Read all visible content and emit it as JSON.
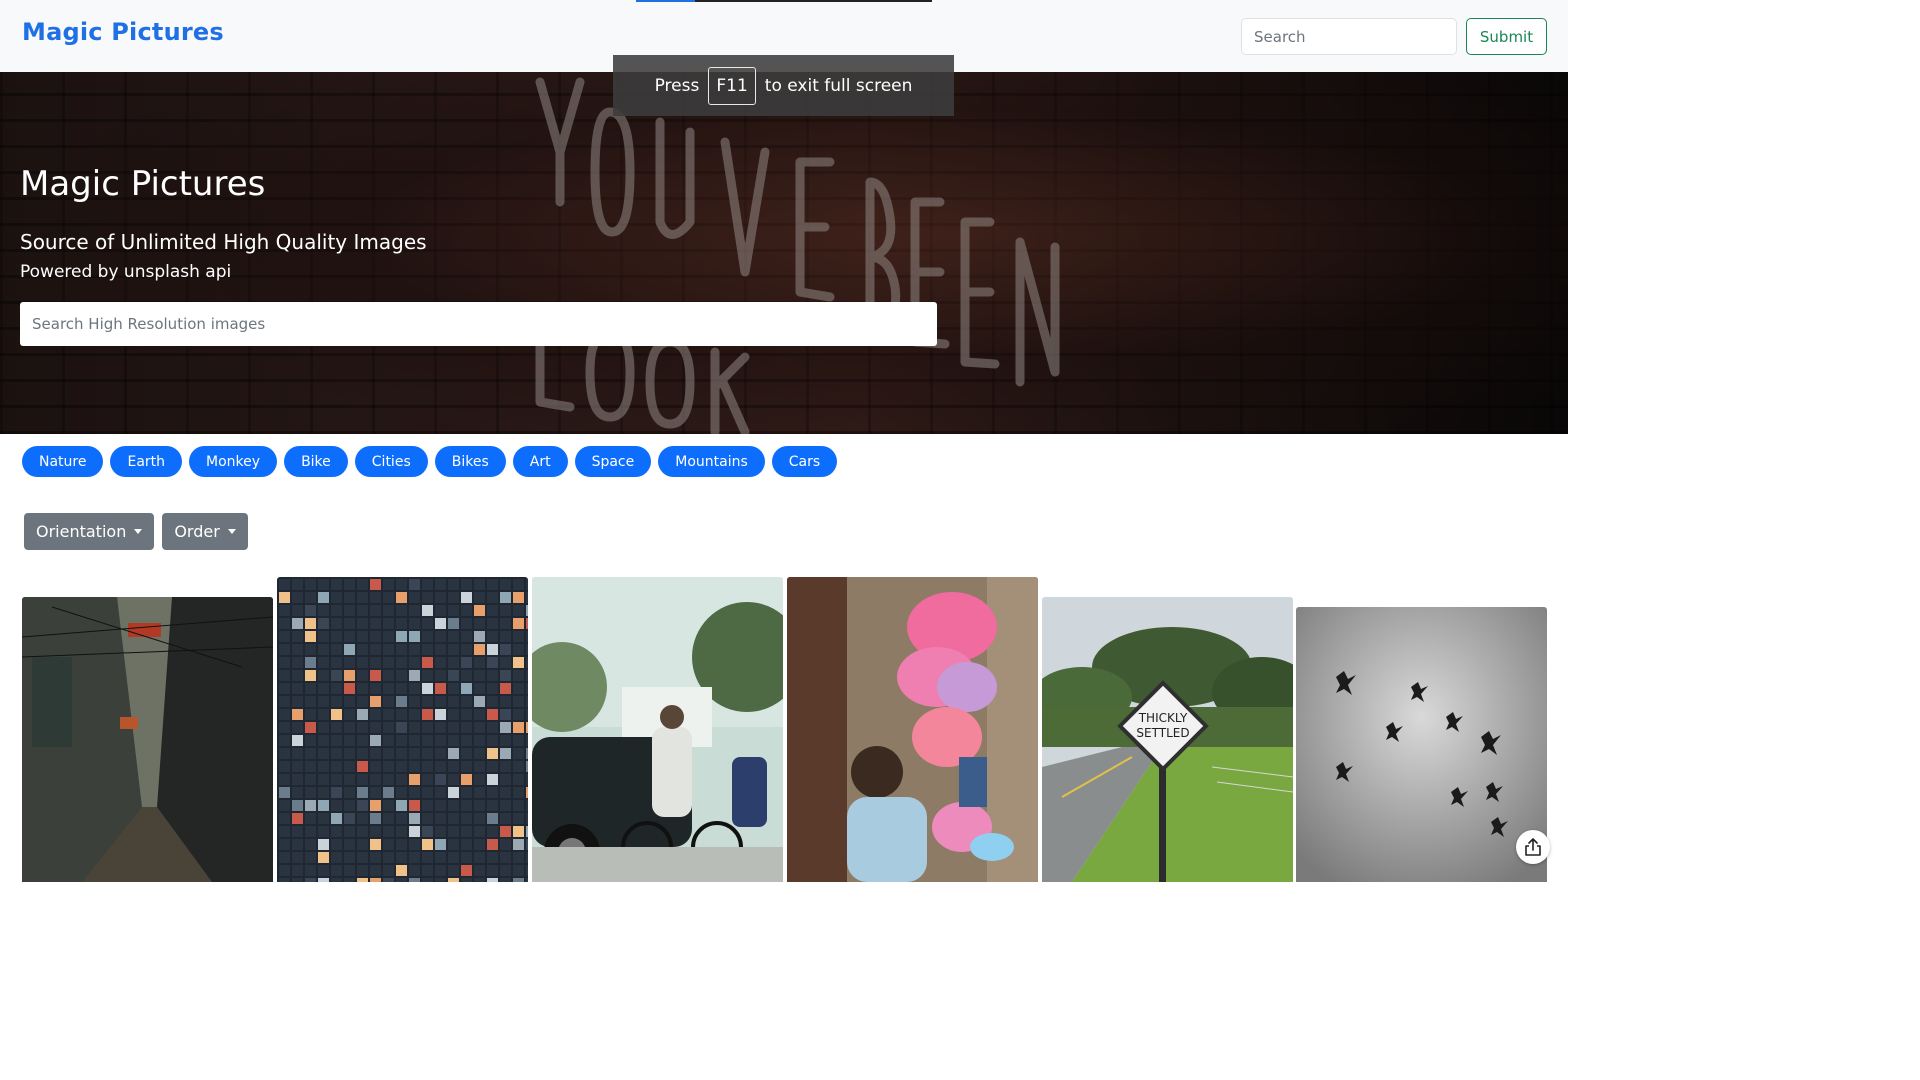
{
  "navbar": {
    "brand": "Magic Pictures",
    "search_placeholder": "Search",
    "submit_label": "Submit",
    "loading_progress_percent": 20
  },
  "fullscreen_notice": {
    "prefix": "Press",
    "key": "F11",
    "suffix": "to exit full screen"
  },
  "hero": {
    "title": "Magic Pictures",
    "subtitle": "Source of Unlimited High Quality Images",
    "powered_by": "Powered by unsplash api",
    "search_placeholder": "Search High Resolution images"
  },
  "tags": [
    "Nature",
    "Earth",
    "Monkey",
    "Bike",
    "Cities",
    "Bikes",
    "Art",
    "Space",
    "Mountains",
    "Cars"
  ],
  "filters": {
    "orientation_label": "Orientation",
    "order_label": "Order"
  },
  "gallery": {
    "photos": [
      {
        "subject": "narrow market alley"
      },
      {
        "subject": "mosaic tile pattern"
      },
      {
        "subject": "cyclists and car on street"
      },
      {
        "subject": "cotton candy vendor"
      },
      {
        "subject": "road sign on rural road",
        "sign_text_line1": "THICKLY",
        "sign_text_line2": "SETTLED"
      },
      {
        "subject": "birds in grey sky"
      }
    ]
  },
  "icons": {
    "share": "share-icon",
    "caret": "caret-down-icon"
  },
  "colors": {
    "brand": "#1f6fe5",
    "tag_bg": "#0d6efd",
    "dropdown_bg": "#6c757d",
    "submit_outline": "#198754"
  }
}
